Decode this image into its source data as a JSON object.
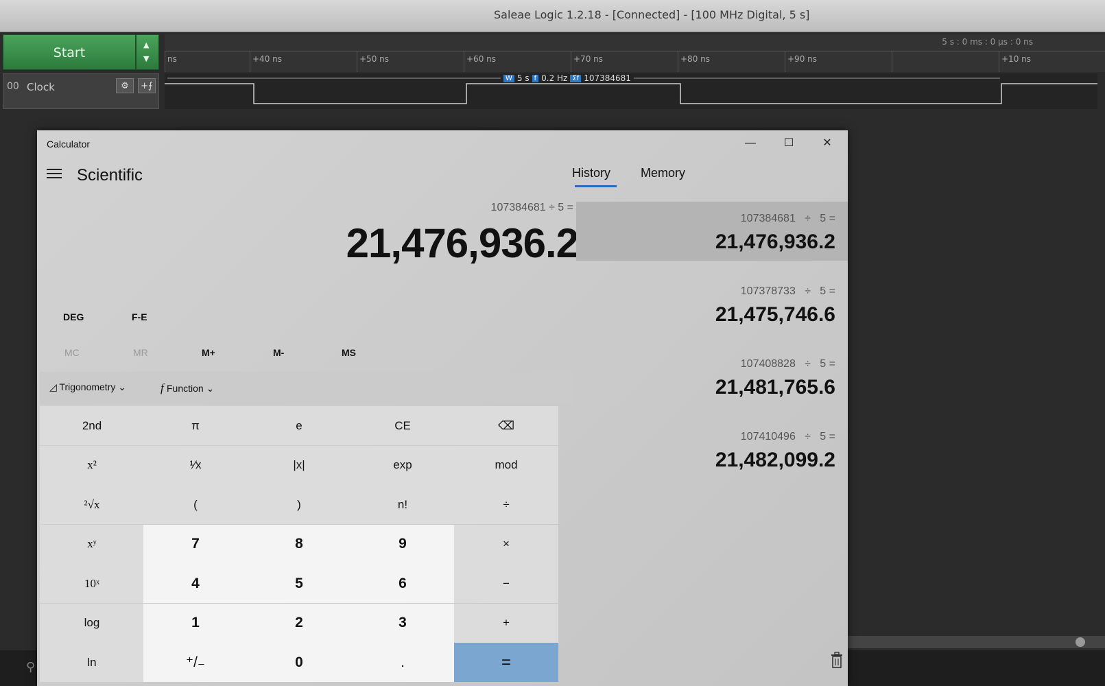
{
  "saleae": {
    "title": "Saleae Logic 1.2.18 - [Connected] - [100 MHz Digital, 5 s]",
    "start_label": "Start",
    "abs_time": "5 s : 0 ms : 0 µs : 0 ns",
    "ticks": [
      "ns",
      "+40 ns",
      "+50 ns",
      "+60 ns",
      "+70 ns",
      "+80 ns",
      "+90 ns",
      "+10 ns"
    ],
    "channel": {
      "number": "00",
      "name": "Clock"
    },
    "measure": {
      "width": "5 s",
      "freq": "0.2 Hz",
      "count": "107384681"
    },
    "colors": {
      "start_green": "#2c7a3c",
      "wave": "#cfcfcf"
    }
  },
  "calc": {
    "window_title": "Calculator",
    "controls": {
      "minimize": "—",
      "maximize": "☐",
      "close": "✕"
    },
    "mode": "Scientific",
    "expression": "107384681 ÷ 5 =",
    "result": "21,476,936.2",
    "deg": "DEG",
    "fe": "F-E",
    "memory_buttons": [
      "MC",
      "MR",
      "M+",
      "M-",
      "MS"
    ],
    "trig_label": "Trigonometry",
    "func_label": "Function",
    "keys": [
      [
        "2nd",
        "π",
        "e",
        "CE",
        "⌫"
      ],
      [
        "x²",
        "¹⁄x",
        "|x|",
        "exp",
        "mod"
      ],
      [
        "²√x",
        "(",
        ")",
        "n!",
        "÷"
      ],
      [
        "xʸ",
        "7",
        "8",
        "9",
        "×"
      ],
      [
        "10ˣ",
        "4",
        "5",
        "6",
        "−"
      ],
      [
        "log",
        "1",
        "2",
        "3",
        "+"
      ],
      [
        "ln",
        "⁺/₋",
        "0",
        ".",
        "="
      ]
    ],
    "tabs": [
      "History",
      "Memory"
    ],
    "history": [
      {
        "expr": "107384681   ÷   5 =",
        "result": "21,476,936.2"
      },
      {
        "expr": "107378733   ÷   5 =",
        "result": "21,475,746.6"
      },
      {
        "expr": "107408828   ÷   5 =",
        "result": "21,481,765.6"
      },
      {
        "expr": "107410496   ÷   5 =",
        "result": "21,482,099.2"
      }
    ],
    "colors": {
      "accent": "#2a6bbf",
      "equals": "#7aa6cf"
    }
  }
}
